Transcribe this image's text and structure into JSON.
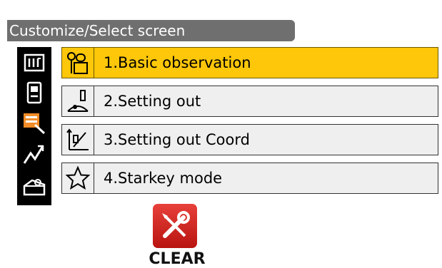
{
  "header": {
    "title": "Customize/Select screen"
  },
  "sidebar": {
    "icons": [
      "pages-icon",
      "device-icon",
      "observation-list-icon",
      "measure-graph-icon",
      "toolbox-icon"
    ]
  },
  "menu": {
    "selected_index": 0,
    "items": [
      {
        "label": "1.Basic observation",
        "icon": "surveyor-icon"
      },
      {
        "label": "2.Setting out",
        "icon": "setting-out-icon"
      },
      {
        "label": "3.Setting out Coord",
        "icon": "setting-out-coord-icon"
      },
      {
        "label": "4.Starkey mode",
        "icon": "star-icon"
      }
    ]
  },
  "clear_button": {
    "label": "CLEAR",
    "icon": "tools-icon"
  },
  "colors": {
    "selected_row": "#ffc709",
    "row_bg": "#efefef",
    "title_bar": "#6f6f6f",
    "clear_red": "#d42a24"
  }
}
